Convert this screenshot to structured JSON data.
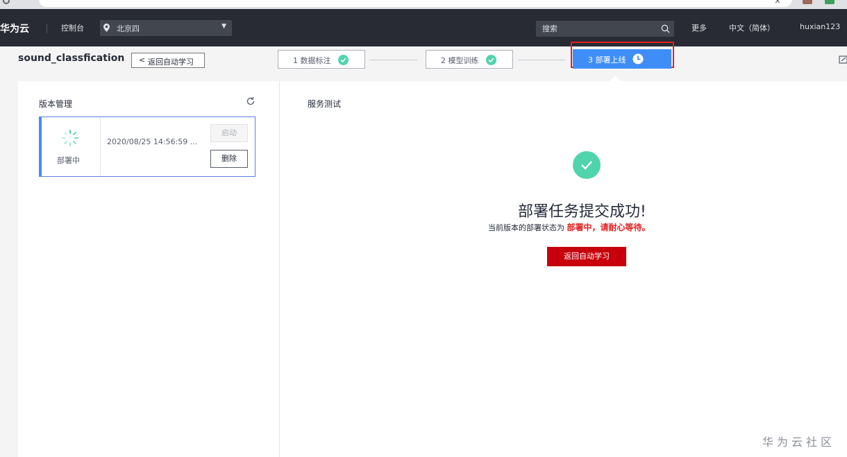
{
  "nav": {
    "brand": "华为云",
    "console": "控制台",
    "region": "北京四",
    "search_placeholder": "搜索",
    "more": "更多",
    "language": "中文（简体）",
    "username": "huxian123"
  },
  "header": {
    "project_title": "sound_classfication",
    "back_label": "返回自动学习",
    "steps": [
      {
        "label": "1 数据标注",
        "state": "completed"
      },
      {
        "label": "2 模型训练",
        "state": "completed"
      },
      {
        "label": "3 部署上线",
        "state": "in-progress"
      }
    ]
  },
  "versions": {
    "title": "版本管理",
    "items": [
      {
        "status": "部署中",
        "time": "2020/08/25 14:56:59 ...",
        "start_label": "启动",
        "delete_label": "删除"
      }
    ]
  },
  "service": {
    "title": "服务测试",
    "success_title": "部署任务提交成功!",
    "status_prefix": "当前版本的部署状态为",
    "status_highlight": "部署中，请耐心等待。",
    "return_label": "返回自动学习"
  },
  "watermark": "华为云社区",
  "colors": {
    "nav_bg": "#282b33",
    "accent_blue": "#3f8ef7",
    "success_green": "#50d4ab",
    "primary_red": "#c7000b",
    "highlight_red": "#e02020"
  }
}
